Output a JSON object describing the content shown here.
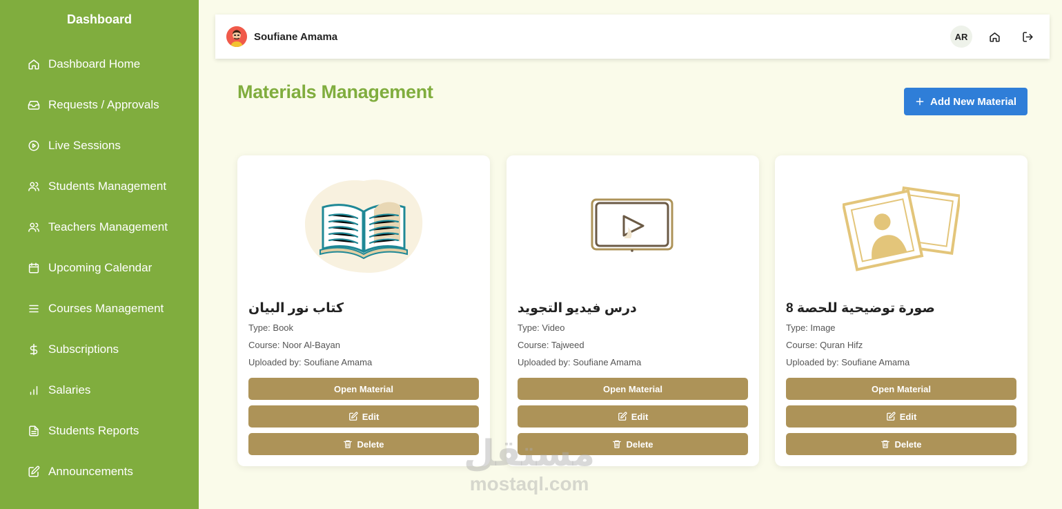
{
  "sidebar": {
    "brand": "Dashboard",
    "items": [
      {
        "label": "Dashboard Home",
        "icon": "home-icon"
      },
      {
        "label": "Requests / Approvals",
        "icon": "inbox-icon"
      },
      {
        "label": "Live Sessions",
        "icon": "play-circle-icon"
      },
      {
        "label": "Students Management",
        "icon": "users-icon"
      },
      {
        "label": "Teachers Management",
        "icon": "users-icon"
      },
      {
        "label": "Upcoming Calendar",
        "icon": "calendar-icon"
      },
      {
        "label": "Courses Management",
        "icon": "menu-icon"
      },
      {
        "label": "Subscriptions",
        "icon": "dollar-icon"
      },
      {
        "label": "Salaries",
        "icon": "bar-chart-icon"
      },
      {
        "label": "Students Reports",
        "icon": "file-text-icon"
      },
      {
        "label": "Announcements",
        "icon": "edit-icon"
      }
    ]
  },
  "topbar": {
    "user_name": "Soufiane Amama",
    "language": "AR",
    "home_icon": "home-icon",
    "logout_icon": "logout-icon"
  },
  "page": {
    "title": "Materials Management",
    "add_button": "Add New Material"
  },
  "materials": [
    {
      "title": "كتاب نور البيان",
      "type": "Type: Book",
      "course": "Course: Noor Al-Bayan",
      "uploaded_by": "Uploaded by: Soufiane Amama",
      "illustration": "open-book-icon"
    },
    {
      "title": "درس فيديو التجويد",
      "type": "Type: Video",
      "course": "Course: Tajweed",
      "uploaded_by": "Uploaded by: Soufiane Amama",
      "illustration": "video-player-icon"
    },
    {
      "title": "صورة توضيحية للحصة 8",
      "type": "Type: Image",
      "course": "Course: Quran Hifz",
      "uploaded_by": "Uploaded by: Soufiane Amama",
      "illustration": "photo-frames-icon"
    }
  ],
  "card_actions": {
    "open": "Open Material",
    "edit": "Edit",
    "delete": "Delete"
  },
  "watermark": {
    "arabic": "مستقل",
    "latin": "mostaql.com"
  },
  "colors": {
    "sidebar": "#80ad3e",
    "accent_green": "#80ad3e",
    "primary_blue": "#2f7ed8",
    "action_gold": "#ad9358",
    "background": "#fafbea"
  }
}
